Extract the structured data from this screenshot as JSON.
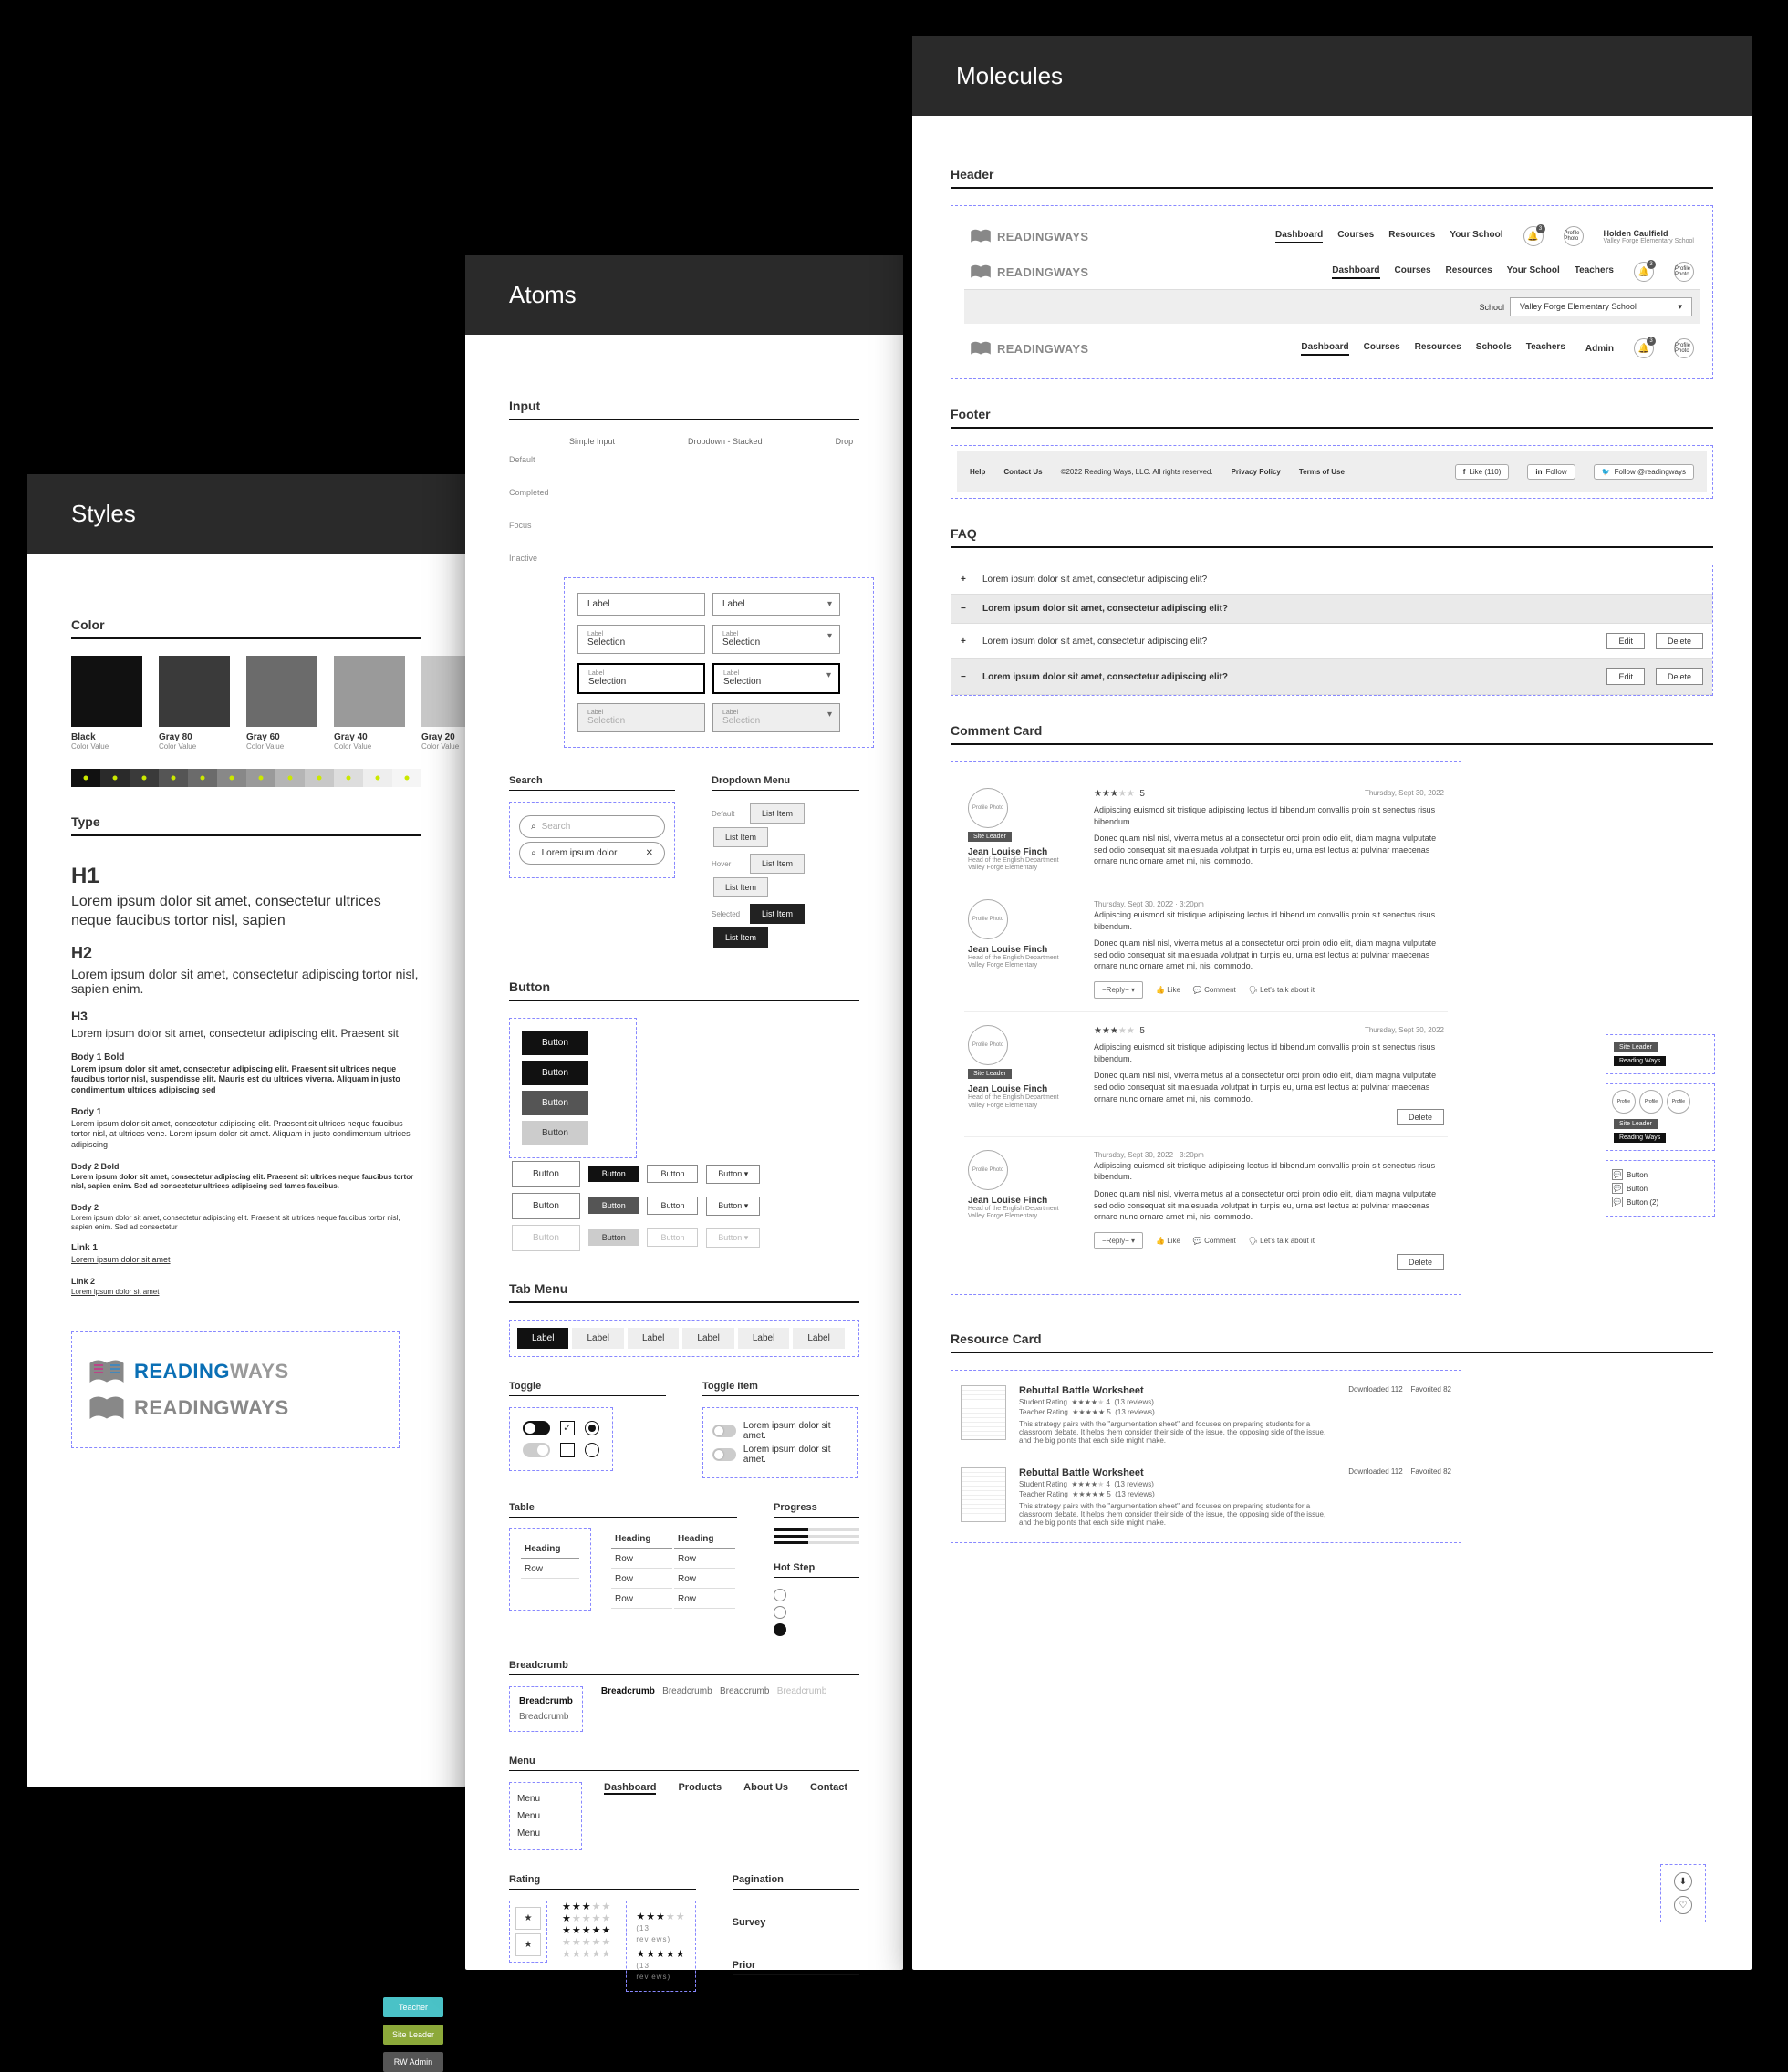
{
  "styles": {
    "title": "Styles",
    "sections": {
      "color": "Color",
      "type": "Type"
    },
    "swatches": [
      {
        "name": "Black",
        "sub": "Color Value",
        "hex": "#111111"
      },
      {
        "name": "Gray 80",
        "sub": "Color Value",
        "hex": "#3a3a3a"
      },
      {
        "name": "Gray 60",
        "sub": "Color Value",
        "hex": "#6b6b6b"
      },
      {
        "name": "Gray 40",
        "sub": "Color Value",
        "hex": "#9a9a9a"
      },
      {
        "name": "Gray 20",
        "sub": "Color Value",
        "hex": "#c8c8c8"
      }
    ],
    "type": {
      "h1": "H1",
      "h1p": "Lorem ipsum dolor sit amet, consectetur ultrices neque faucibus tortor nisl, sapien",
      "h2": "H2",
      "h2p": "Lorem ipsum dolor sit amet, consectetur adipiscing tortor nisl, sapien enim.",
      "h3": "H3",
      "h3p": "Lorem ipsum dolor sit amet, consectetur adipiscing elit. Praesent sit",
      "b1b": "Body 1 Bold",
      "b1bp": "Lorem ipsum dolor sit amet, consectetur adipiscing elit. Praesent sit ultrices neque faucibus tortor nisl, suspendisse elit. Mauris est du ultrices viverra. Aliquam in justo condimentum ultrices adipiscing sed",
      "b1": "Body 1",
      "b1p": "Lorem ipsum dolor sit amet, consectetur adipiscing elit. Praesent sit ultrices neque faucibus tortor nisl, at ultrices vene. Lorem ipsum dolor sit amet. Aliquam in justo condimentum ultrices adipiscing",
      "b2b": "Body 2 Bold",
      "b2bp": "Lorem ipsum dolor sit amet, consectetur adipiscing elit. Praesent sit ultrices neque faucibus tortor nisl, sapien enim. Sed ad consectetur ultrices adipiscing sed fames faucibus.",
      "b2": "Body 2",
      "b2p": "Lorem ipsum dolor sit amet, consectetur adipiscing elit. Praesent sit ultrices neque faucibus tortor nisl, sapien enim. Sed ad consectetur",
      "l1": "Link 1",
      "l1t": "Lorem ipsum dolor sit amet",
      "l2": "Link 2",
      "l2t": "Lorem ipsum dolor sit amet"
    },
    "logo": {
      "brand1": "READING",
      "brand2": "WAYS"
    },
    "tags": [
      "Teacher",
      "Site Leader",
      "RW Admin"
    ]
  },
  "atoms": {
    "title": "Atoms",
    "sections": {
      "input": "Input",
      "search": "Search",
      "dropdown": "Dropdown Menu",
      "button": "Button",
      "tabmenu": "Tab Menu",
      "toggle": "Toggle",
      "toggleitem": "Toggle Item",
      "table": "Table",
      "breadcrumb": "Breadcrumb",
      "menu": "Menu",
      "rating": "Rating",
      "progress": "Progress",
      "hotstep": "Hot Step",
      "pagination": "Pagination",
      "survey": "Survey",
      "prior": "Prior"
    },
    "inputCols": [
      "Simple Input",
      "Dropdown - Stacked",
      "Drop"
    ],
    "inputRows": [
      "Default",
      "Completed",
      "Focus",
      "Inactive"
    ],
    "inputVals": {
      "label": "Label",
      "selection": "Selection"
    },
    "search": {
      "ph": "Search",
      "val": "Lorem ipsum dolor"
    },
    "ddStates": [
      "Default",
      "Hover",
      "Selected"
    ],
    "listItem": "List Item",
    "buttonLabel": "Button",
    "tabLabel": "Label",
    "toggleItem": "Lorem ipsum dolor sit amet.",
    "table": {
      "heading": "Heading",
      "row": "Row"
    },
    "crumb": "Breadcrumb",
    "menu": {
      "item": "Menu",
      "links": [
        "Dashboard",
        "Products",
        "About Us",
        "Contact"
      ]
    },
    "ratingCount": "(13 reviews)"
  },
  "molecules": {
    "title": "Molecules",
    "sections": {
      "header": "Header",
      "footer": "Footer",
      "faq": "FAQ",
      "comment": "Comment Card",
      "resource": "Resource Card"
    },
    "logo": {
      "t": "READINGWAYS"
    },
    "nav1": [
      "Dashboard",
      "Courses",
      "Resources",
      "Your School"
    ],
    "nav2": [
      "Dashboard",
      "Courses",
      "Resources",
      "Your School",
      "Teachers"
    ],
    "nav3": [
      "Dashboard",
      "Courses",
      "Resources",
      "Schools",
      "Teachers"
    ],
    "admin": "Admin",
    "notif": "3",
    "profile": {
      "ph": "Profile Photo",
      "name": "Holden Caulfield",
      "school": "Valley Forge Elementary School"
    },
    "schoolSel": {
      "lbl": "School",
      "val": "Valley Forge Elementary School"
    },
    "footer": {
      "help": "Help",
      "contact": "Contact Us",
      "copy": "©2022 Reading Ways, LLC. All rights reserved.",
      "priv": "Privacy Policy",
      "terms": "Terms of Use",
      "like": "Like (110)",
      "follow": "Follow",
      "follow2": "Follow @readingways"
    },
    "faq": {
      "q": "Lorem ipsum dolor sit amet, consectetur adipiscing elit?",
      "edit": "Edit",
      "del": "Delete"
    },
    "comment": {
      "avatar": "Profile Photo",
      "name": "Jean Louise Finch",
      "role": "Head of the English Department\nValley Forge Elementary",
      "tag": "Site Leader",
      "date1": "Thursday, Sept 30, 2022",
      "date2": "Thursday, Sept 30, 2022 · 3:20pm",
      "rating": "5",
      "p1": "Adipiscing euismod sit tristique adipiscing lectus id bibendum convallis proin sit senectus risus bibendum.",
      "p2": "Donec quam nisl nisl, viverra metus at a consectetur orci proin odio elit, diam magna vulputate sed odio consequat sit malesuada volutpat in turpis eu, urna est lectus at pulvinar maecenas ornare nunc ornare amet mi, nisl commodo.",
      "act": {
        "group": "−Reply−",
        "like": "Like",
        "comment": "Comment",
        "talk": "Let's talk about it"
      },
      "delete": "Delete"
    },
    "sidebits": {
      "sl": "Site Leader",
      "rw": "Reading Ways",
      "btn": "Button",
      "btn2": "Button (2)"
    },
    "resource": {
      "title": "Rebuttal Battle Worksheet",
      "sr": "Student Rating",
      "tr": "Teacher Rating",
      "rc": "(13 reviews)",
      "desc": "This strategy pairs with the \"argumentation sheet\" and focuses on preparing students for a classroom debate. It helps them consider their side of the issue, the opposing side of the issue, and the big points that each side might make.",
      "dl": "Downloaded  112",
      "fav": "Favorited  82"
    }
  }
}
